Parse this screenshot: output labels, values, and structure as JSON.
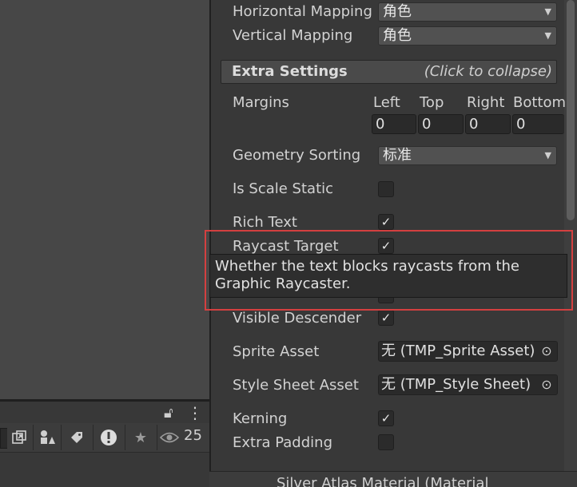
{
  "project_toolbar": {
    "lock_icon": "⌂",
    "menu_icon": "⋮",
    "eye_count": "25"
  },
  "inspector": {
    "horizontal_mapping": {
      "label": "Horizontal Mapping",
      "value": "角色"
    },
    "vertical_mapping": {
      "label": "Vertical Mapping",
      "value": "角色"
    },
    "extra_settings": {
      "title": "Extra Settings",
      "collapse_hint": "(Click to collapse)"
    },
    "margins": {
      "label": "Margins",
      "columns": [
        "Left",
        "Top",
        "Right",
        "Bottom"
      ],
      "values": [
        "0",
        "0",
        "0",
        "0"
      ]
    },
    "geometry_sorting": {
      "label": "Geometry Sorting",
      "value": "标准"
    },
    "is_scale_static": {
      "label": "Is Scale Static",
      "checked": false
    },
    "rich_text": {
      "label": "Rich Text",
      "checked": true
    },
    "raycast_target": {
      "label": "Raycast Target",
      "checked": true
    },
    "hidden_row": {
      "checked": false
    },
    "visible_descender": {
      "label": "Visible Descender",
      "checked": true
    },
    "sprite_asset": {
      "label": "Sprite Asset",
      "value": "无 (TMP_Sprite Asset)"
    },
    "style_sheet_asset": {
      "label": "Style Sheet Asset",
      "value": "无 (TMP_Style Sheet)"
    },
    "kerning": {
      "label": "Kerning",
      "checked": true
    },
    "extra_padding": {
      "label": "Extra Padding",
      "checked": false
    }
  },
  "tooltip": {
    "text_line1": "Whether the text blocks raycasts from the",
    "text_line2": "Graphic Raycaster."
  },
  "bottom_bar": {
    "text": "Silver Atlas Material (Material"
  },
  "colors": {
    "highlight": "#d44040",
    "panel": "#383838",
    "scene": "#474747"
  }
}
